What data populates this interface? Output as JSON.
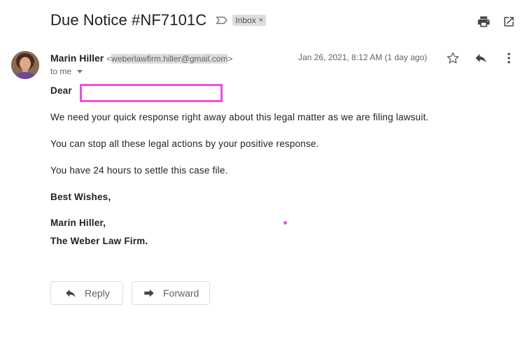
{
  "email": {
    "subject": "Due Notice #NF7101C",
    "label": "Inbox",
    "label_close": "×",
    "sender_name": "Marin Hiller",
    "sender_email_open": "<",
    "sender_email": "weberlawfirm.hiller@gmail.com",
    "sender_email_close": ">",
    "recipient": "to me",
    "date": "Jan 26, 2021, 8:12 AM (1 day ago)"
  },
  "body": {
    "greeting": "Dear",
    "line1": "We need your quick response right away about this legal matter as we are filing lawsuit.",
    "line2": "You can stop all these legal actions by your positive response.",
    "line3": "You have 24 hours to settle this case file.",
    "closing": "Best Wishes,",
    "signature_name": "Marin Hiller,",
    "signature_firm": "The Weber Law Firm."
  },
  "actions": {
    "reply_label": "Reply",
    "forward_label": "Forward"
  },
  "icons": {
    "important": "important-marker-icon",
    "print": "print-icon",
    "open_new_window": "open-in-new-window-icon",
    "star": "star-icon",
    "reply": "reply-icon",
    "more": "more-vertical-icon",
    "forward": "forward-icon"
  },
  "colors": {
    "highlight": "#ec4fe4",
    "label_chip_bg": "#dddddd",
    "secondary_text": "#5f6368"
  }
}
